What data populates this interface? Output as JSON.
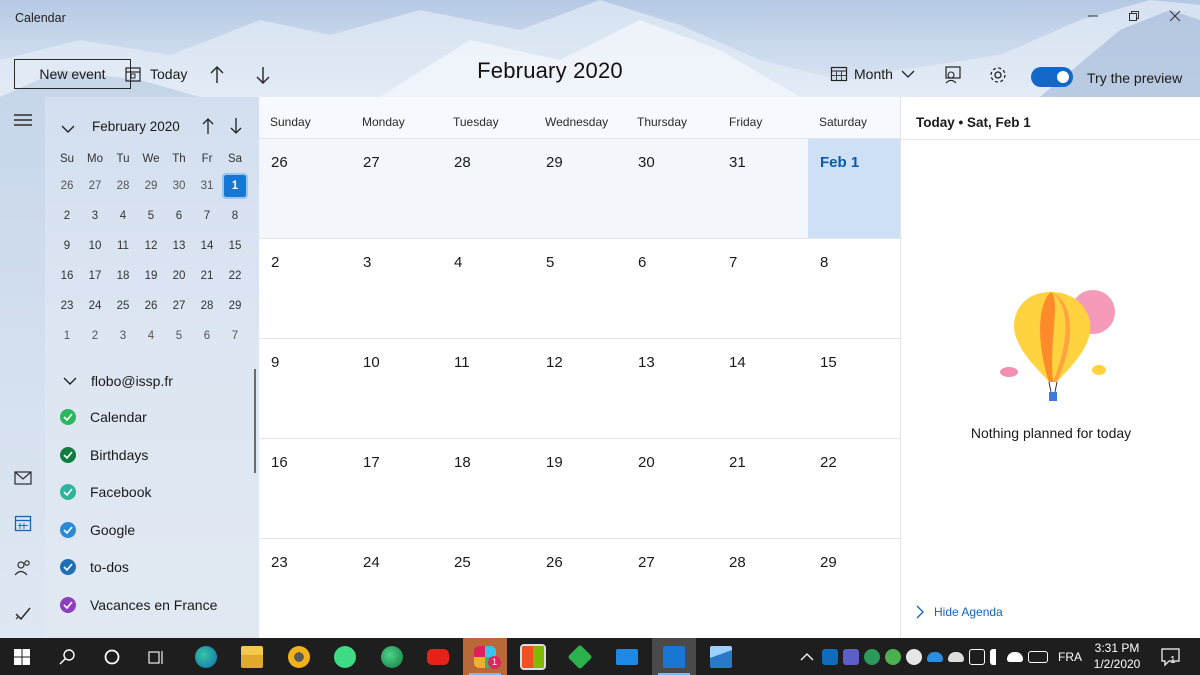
{
  "window": {
    "title": "Calendar",
    "controls": [
      "minimize",
      "restore",
      "close"
    ]
  },
  "toolbar": {
    "new_event_label": "New event",
    "today_label": "Today",
    "view_label": "Month",
    "toggle_label": "Try the preview",
    "toggle_on": true
  },
  "header": {
    "month_title": "February 2020"
  },
  "mini_calendar": {
    "title": "February 2020",
    "days_of_week": [
      "Su",
      "Mo",
      "Tu",
      "We",
      "Th",
      "Fr",
      "Sa"
    ],
    "weeks": [
      [
        "26",
        "27",
        "28",
        "29",
        "30",
        "31",
        "1"
      ],
      [
        "2",
        "3",
        "4",
        "5",
        "6",
        "7",
        "8"
      ],
      [
        "9",
        "10",
        "11",
        "12",
        "13",
        "14",
        "15"
      ],
      [
        "16",
        "17",
        "18",
        "19",
        "20",
        "21",
        "22"
      ],
      [
        "23",
        "24",
        "25",
        "26",
        "27",
        "28",
        "29"
      ],
      [
        "1",
        "2",
        "3",
        "4",
        "5",
        "6",
        "7"
      ]
    ],
    "selected": "1"
  },
  "accounts": {
    "email": "flobo@issp.fr",
    "calendars": [
      {
        "name": "Calendar",
        "color": "#2bb85c"
      },
      {
        "name": "Birthdays",
        "color": "#107c41"
      },
      {
        "name": "Facebook",
        "color": "#2bb59a"
      },
      {
        "name": "Google",
        "color": "#2b8ad4"
      },
      {
        "name": "to-dos",
        "color": "#1f6fb2"
      },
      {
        "name": "Vacances en France",
        "color": "#8b3fbf"
      }
    ]
  },
  "month_grid": {
    "days_of_week": [
      "Sunday",
      "Monday",
      "Tuesday",
      "Wednesday",
      "Thursday",
      "Friday",
      "Saturday"
    ],
    "weeks": [
      [
        "26",
        "27",
        "28",
        "29",
        "30",
        "31",
        "Feb 1"
      ],
      [
        "2",
        "3",
        "4",
        "5",
        "6",
        "7",
        "8"
      ],
      [
        "9",
        "10",
        "11",
        "12",
        "13",
        "14",
        "15"
      ],
      [
        "16",
        "17",
        "18",
        "19",
        "20",
        "21",
        "22"
      ],
      [
        "23",
        "24",
        "25",
        "26",
        "27",
        "28",
        "29"
      ]
    ],
    "today": "Feb 1"
  },
  "agenda": {
    "header": "Today • Sat, Feb 1",
    "empty_message": "Nothing planned for today",
    "hide_label": "Hide Agenda"
  },
  "taskbar": {
    "apps": [
      "start",
      "search",
      "cortana",
      "task-view",
      "edge-can",
      "file-explorer",
      "chrome-canary",
      "android-studio",
      "edge-dev",
      "youtube",
      "slack",
      "store",
      "feedly",
      "mail",
      "calendar",
      "photos"
    ],
    "language": "FRA",
    "time": "3:31 PM",
    "date": "1/2/2020",
    "notification_count": "1",
    "slack_badge": "1"
  },
  "colors": {
    "accent": "#1478d4",
    "today_fill": "#cde0f5",
    "taskbar": "#1e1e1e"
  }
}
